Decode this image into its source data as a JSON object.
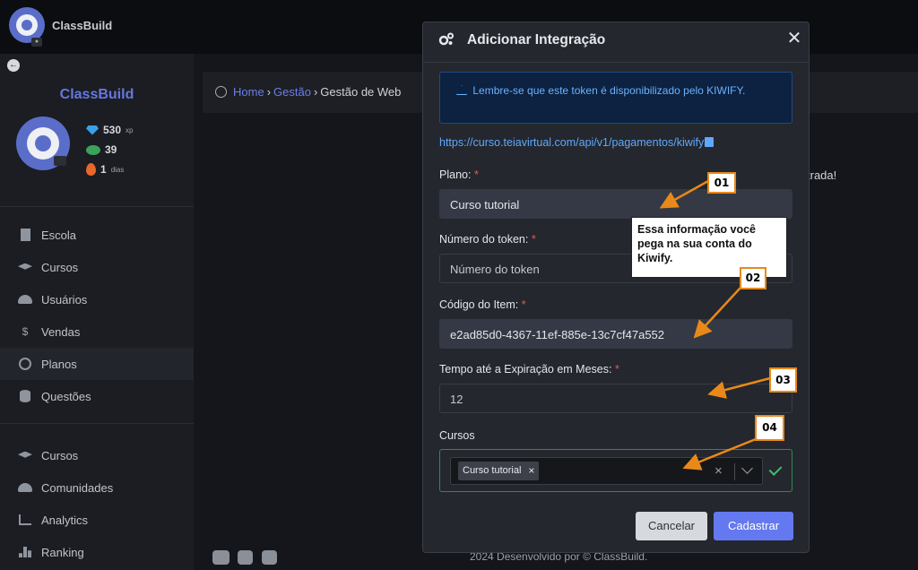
{
  "app": {
    "brand": "ClassBuild"
  },
  "profile": {
    "xp_value": "530",
    "xp_unit": "xp",
    "coins": "39",
    "streak_value": "1",
    "streak_unit": "dias"
  },
  "sidebar": {
    "group1": [
      {
        "label": "Escola",
        "icon": "building-icon"
      },
      {
        "label": "Cursos",
        "icon": "graduation-cap-icon"
      },
      {
        "label": "Usuários",
        "icon": "users-icon"
      },
      {
        "label": "Vendas",
        "icon": "dollar-icon"
      },
      {
        "label": "Planos",
        "icon": "share-nodes-icon"
      },
      {
        "label": "Questões",
        "icon": "database-icon"
      }
    ],
    "group2": [
      {
        "label": "Cursos",
        "icon": "graduation-cap-icon"
      },
      {
        "label": "Comunidades",
        "icon": "users-icon"
      },
      {
        "label": "Analytics",
        "icon": "chart-line-icon"
      },
      {
        "label": "Ranking",
        "icon": "ranking-icon"
      }
    ]
  },
  "breadcrumb": {
    "home": "Home",
    "gestao": "Gestão",
    "current": "Gestão de Web"
  },
  "background_text": "trada!",
  "footer": {
    "text": "2024 Desenvolvido por © ClassBuild."
  },
  "modal": {
    "title": "Adicionar Integração",
    "alert_text": "Lembre-se que este token é disponibilizado pelo KIWIFY.",
    "url": "https://curso.teiavirtual.com/api/v1/pagamentos/kiwify",
    "plano_label": "Plano:",
    "plano_value": "Curso tutorial",
    "token_label": "Número do token:",
    "token_placeholder": "Número do token",
    "item_label": "Código do Item:",
    "item_value": "e2ad85d0-4367-11ef-885e-13c7cf47a552",
    "expiry_label": "Tempo até a Expiração em Meses:",
    "expiry_value": "12",
    "cursos_label": "Cursos",
    "cursos_tag": "Curso tutorial",
    "cursos_tag_remove": "×",
    "clear_symbol": "×",
    "required_mark": "*",
    "cancel_label": "Cancelar",
    "submit_label": "Cadastrar",
    "close_symbol": "✕"
  },
  "annotations": {
    "c01": "01",
    "c02": "02",
    "c03": "03",
    "c04": "04",
    "note": "Essa informação você pega na sua conta do Kiwify.",
    "color": "#e8891a"
  },
  "colors": {
    "accent": "#6479f0",
    "success": "#3fbf72",
    "alert": "#68b3ff"
  }
}
